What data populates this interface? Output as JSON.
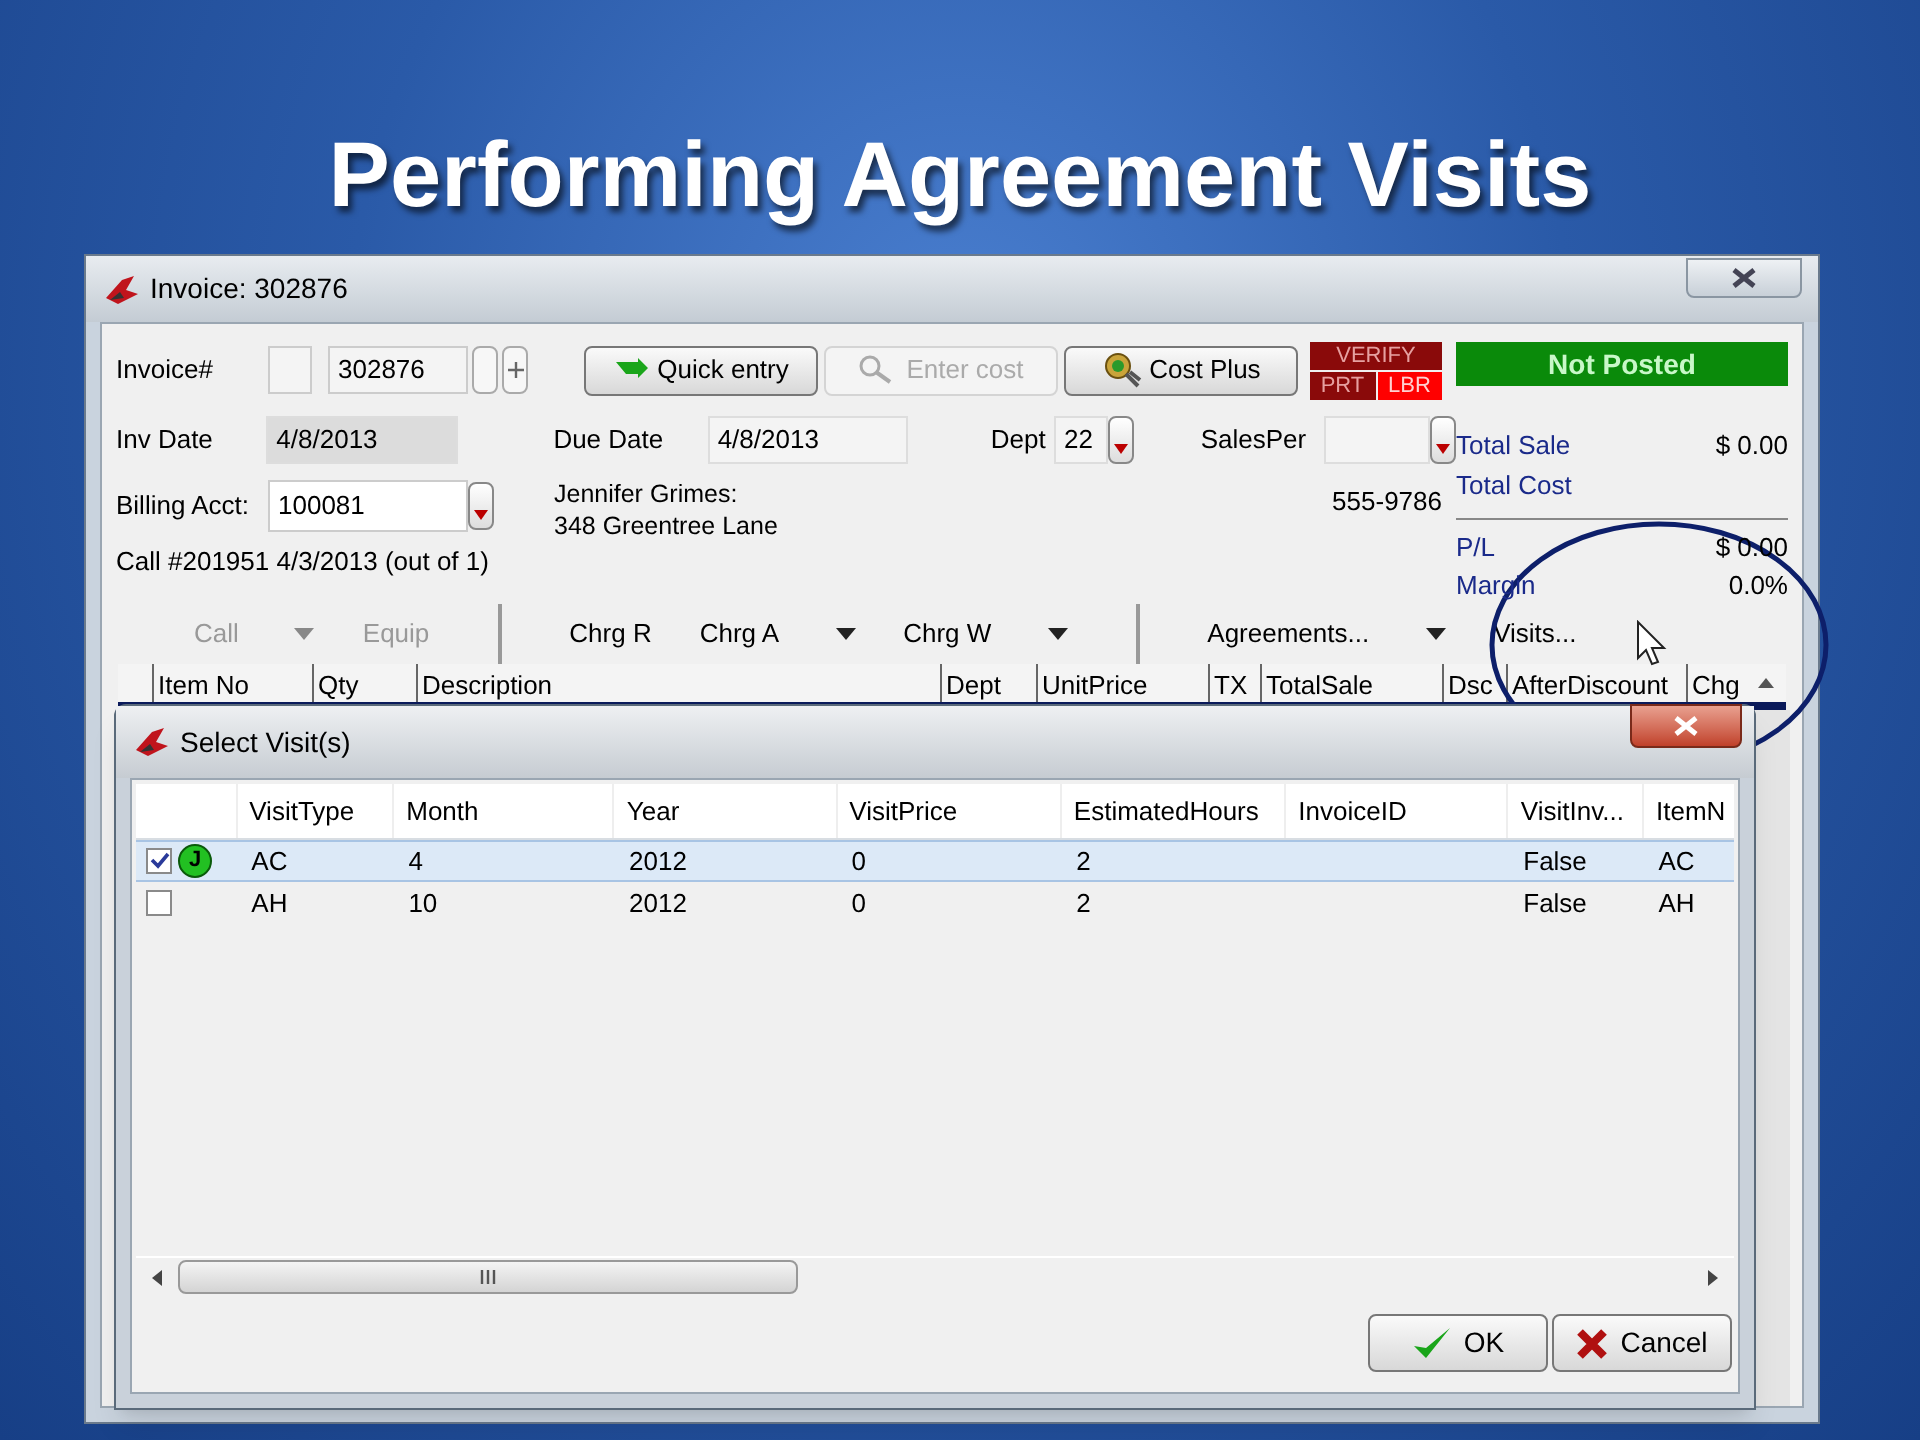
{
  "slide_title": "Performing Agreement Visits",
  "invoice_window": {
    "title": "Invoice: 302876",
    "invoice_label": "Invoice#",
    "invoice_number": "302876",
    "buttons": [
      {
        "label": "Quick entry",
        "kind": "quick",
        "disabled": false
      },
      {
        "label": "Enter cost",
        "kind": "cost",
        "disabled": true
      },
      {
        "label": "Cost Plus",
        "kind": "plus",
        "disabled": false
      }
    ],
    "badges": [
      "VERIFY",
      "PRT",
      "LBR"
    ],
    "status": "Not Posted",
    "inv_date_label": "Inv Date",
    "inv_date": "4/8/2013",
    "due_date_label": "Due Date",
    "due_date": "4/8/2013",
    "dept_label": "Dept",
    "dept": "22",
    "salesper_label": "SalesPer",
    "billing_label": "Billing Acct:",
    "billing_acct": "100081",
    "customer_name": "Jennifer Grimes:",
    "customer_address": "348 Greentree Lane",
    "phone": "555-9786",
    "call_info": "Call #201951 4/3/2013 (out of 1)",
    "totals": [
      {
        "label": "Total Sale",
        "value": "$ 0.00"
      },
      {
        "label": "Total Cost"
      }
    ],
    "results": [
      {
        "label": "P/L",
        "value": "$ 0.00"
      },
      {
        "label": "Margin",
        "value": "0.0%"
      }
    ],
    "toolbar": [
      {
        "label": "Call",
        "disabled": true,
        "caret": true,
        "separator_after": false
      },
      {
        "label": "Equip",
        "disabled": true,
        "caret": false,
        "separator_after": true
      },
      {
        "label": "Chrg R",
        "disabled": false,
        "caret": false,
        "separator_after": false
      },
      {
        "label": "Chrg A",
        "disabled": false,
        "caret": true,
        "separator_after": false
      },
      {
        "label": "Chrg W",
        "disabled": false,
        "caret": true,
        "separator_after": true
      },
      {
        "label": "Agreements...",
        "disabled": false,
        "caret": true,
        "separator_after": false
      },
      {
        "label": "Visits...",
        "disabled": false,
        "caret": false,
        "separator_after": false
      }
    ],
    "columns": [
      "Item No",
      "Qty",
      "Description",
      "Dept",
      "UnitPrice",
      "TX",
      "TotalSale",
      "Dsc",
      "AfterDiscount",
      "Chg"
    ]
  },
  "dialog": {
    "title": "Select Visit(s)",
    "columns": [
      "VisitType",
      "Month",
      "Year",
      "VisitPrice",
      "EstimatedHours",
      "InvoiceID",
      "VisitInv...",
      "ItemN"
    ],
    "rows": [
      {
        "checked": true,
        "selected": true,
        "status_letter": "J",
        "cells": [
          "AC",
          "4",
          "2012",
          "0",
          "2",
          "",
          "False",
          "AC"
        ]
      },
      {
        "checked": false,
        "selected": false,
        "cells": [
          "AH",
          "10",
          "2012",
          "0",
          "2",
          "",
          "False",
          "AH"
        ]
      }
    ],
    "buttons": [
      {
        "label": "OK",
        "kind": "ok"
      },
      {
        "label": "Cancel",
        "kind": "cancel"
      }
    ]
  }
}
